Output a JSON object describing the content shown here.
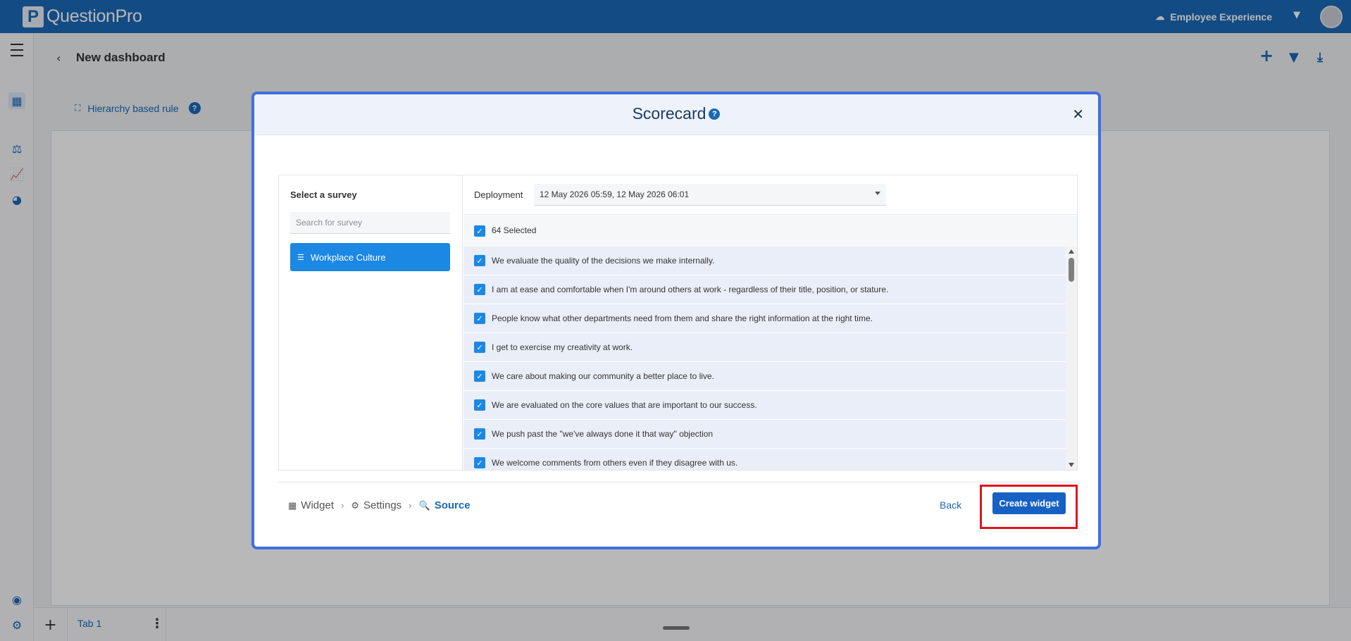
{
  "topbar": {
    "logo_mark": "P",
    "logo_text": "QuestionPro",
    "product": "Employee Experience"
  },
  "dashboard": {
    "title": "New dashboard",
    "hierarchy_rule": "Hierarchy based rule"
  },
  "tabs": [
    {
      "label": "Tab 1"
    }
  ],
  "modal": {
    "title": "Scorecard",
    "select_survey_label": "Select a survey",
    "search_placeholder": "Search for survey",
    "survey_item": "Workplace Culture",
    "deployment_label": "Deployment",
    "deployment_value": "12 May 2026 05:59, 12 May 2026 06:01",
    "selected_count": "64 Selected",
    "questions": [
      "We evaluate the quality of the decisions we make internally.",
      "I am at ease and comfortable when I'm around others at work - regardless of their title, position, or stature.",
      "People know what other departments need from them and share the right information at the right time.",
      "I get to exercise my creativity at work.",
      "We care about making our community a better place to live.",
      "We are evaluated on the core values that are important to our success.",
      "We push past the \"we've always done it that way\" objection",
      "We welcome comments from others even if they disagree with us."
    ],
    "breadcrumb": {
      "widget": "Widget",
      "settings": "Settings",
      "source": "Source"
    },
    "back_label": "Back",
    "create_label": "Create widget"
  },
  "colors": {
    "brand": "#1b69b7",
    "selected": "#1b88e3",
    "highlight": "#e0141c",
    "modal_border": "#3f6fe0"
  }
}
